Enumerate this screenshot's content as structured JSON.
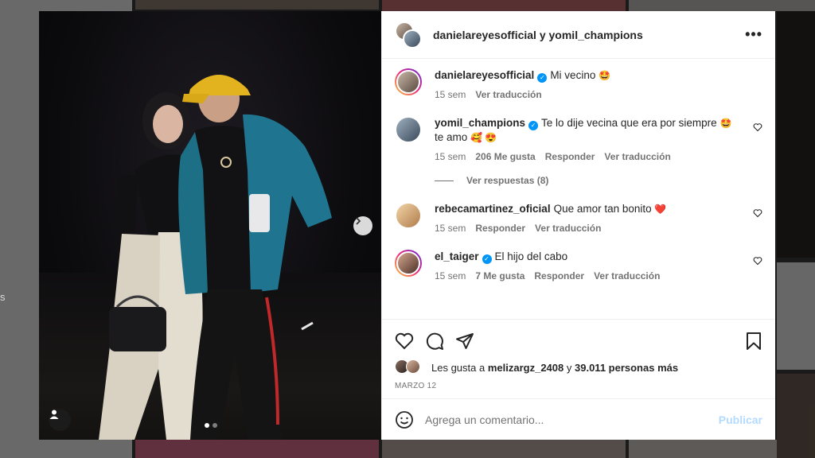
{
  "background": {
    "edge_text": "s"
  },
  "post": {
    "header": {
      "title": "danielareyesofficial y yomil_champions"
    },
    "caption": {
      "username": "danielareyesofficial",
      "text": "Mi vecino",
      "emoji": "🤩",
      "time": "15 sem",
      "translate": "Ver traducción"
    },
    "comments": [
      {
        "username": "yomil_champions",
        "verified": true,
        "text": "Te lo dije vecina que era por siempre",
        "emoji": "🤩",
        "text2": "te amo",
        "emoji2": "🥰 😍",
        "time": "15 sem",
        "likes": "206 Me gusta",
        "reply": "Responder",
        "translate": "Ver traducción",
        "view_replies": "Ver respuestas (8)"
      },
      {
        "username": "rebecamartinez_oficial",
        "verified": false,
        "text": "Que amor tan bonito",
        "emoji": "❤️",
        "time": "15 sem",
        "reply": "Responder",
        "translate": "Ver traducción"
      },
      {
        "username": "el_taiger",
        "verified": true,
        "text": "El hijo del cabo",
        "time": "15 sem",
        "likes": "7 Me gusta",
        "reply": "Responder",
        "translate": "Ver traducción"
      }
    ],
    "likes_text_prefix": "Les gusta a",
    "likes_user": "melizargz_2408",
    "likes_join": "y",
    "likes_count": "39.011 personas más",
    "date": "MARZO 12",
    "add_comment_placeholder": "Agrega un comentario...",
    "publish_label": "Publicar",
    "carousel": {
      "current": 1,
      "total": 2
    }
  },
  "colors": {
    "accent": "#0095f6",
    "publish_disabled": "#b3dbff",
    "like_red": "#ed4956"
  },
  "icons": [
    "heart-icon",
    "comment-icon",
    "share-icon",
    "bookmark-icon",
    "more-icon",
    "chevron-right-icon",
    "user-tag-icon",
    "emoji-icon",
    "verified-icon"
  ]
}
